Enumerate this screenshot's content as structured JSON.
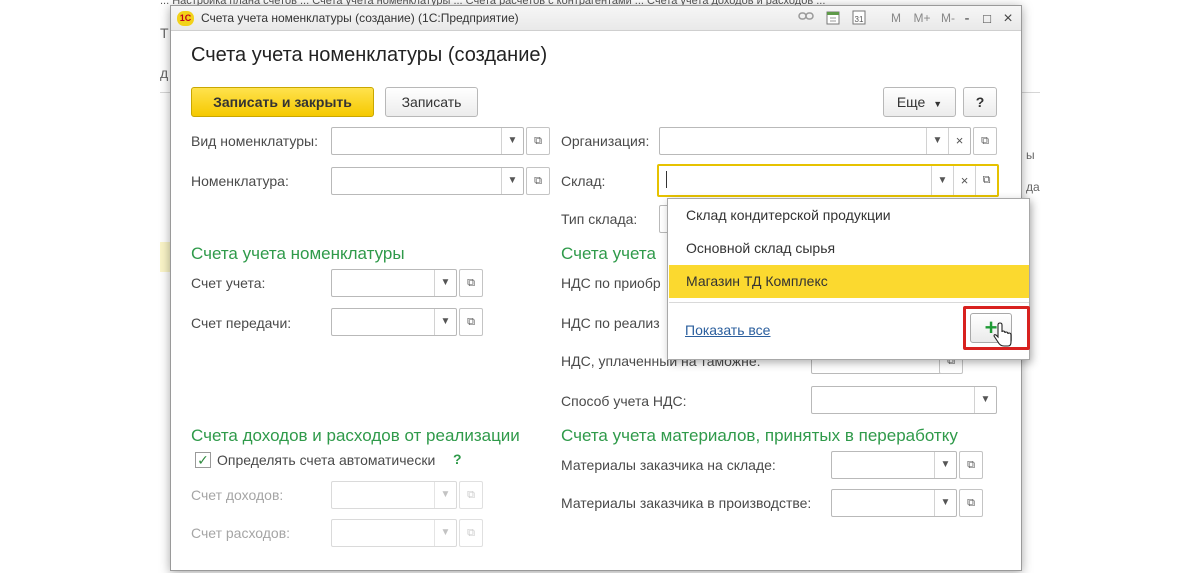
{
  "window": {
    "title": "Счета учета номенклатуры (создание)  (1С:Предприятие)",
    "logo": "1С",
    "toolbar_icons": [
      "link-icon",
      "calendar-icon",
      "calculator-icon"
    ],
    "memory_buttons": [
      "M",
      "M+",
      "M-"
    ],
    "controls": {
      "minimize": "-",
      "maximize": "□",
      "close": "×"
    }
  },
  "background": {
    "tabs_text": "... Настройка плана счетов ... Счета учета номенклатуры ... Счета расчетов с контрагентами ... Счета учета доходов и расходов ...",
    "edge_letters": [
      "Т",
      "д"
    ],
    "right_edge": [
      "ы",
      "да"
    ]
  },
  "page": {
    "title": "Счета учета номенклатуры (создание)"
  },
  "toolbar": {
    "save_close": "Записать и закрыть",
    "save": "Записать",
    "more": "Еще",
    "help": "?"
  },
  "fields": {
    "nomenclature_type": {
      "label": "Вид номенклатуры:",
      "value": ""
    },
    "nomenclature": {
      "label": "Номенклатура:",
      "value": ""
    },
    "organization": {
      "label": "Организация:",
      "value": ""
    },
    "warehouse": {
      "label": "Склад:",
      "value": ""
    },
    "warehouse_type": {
      "label": "Тип склада:"
    }
  },
  "sections": {
    "nomenclature_accounts": {
      "title": "Счета учета номенклатуры",
      "account": "Счет учета:",
      "transfer": "Счет передачи:"
    },
    "vat": {
      "title": "Счета учета",
      "vat_purchase": "НДС по приобр",
      "vat_sales": "НДС по реализ",
      "vat_customs": "НДС, уплаченный на таможне:",
      "vat_method": "Способ учета НДС:"
    },
    "income": {
      "title": "Счета доходов и расходов от реализации",
      "auto_checkbox": "Определять счета автоматически",
      "auto_checked": true,
      "help": "?",
      "income_account": "Счет доходов:",
      "expense_account": "Счет расходов:"
    },
    "materials": {
      "title": "Счета учета материалов, принятых в переработку",
      "in_warehouse": "Материалы заказчика на складе:",
      "in_production": "Материалы заказчика в производстве:"
    }
  },
  "dropdown": {
    "items": [
      "Склад кондитерской продукции",
      " Основной склад сырья",
      "Магазин ТД Комплекс"
    ],
    "selected_index": 2,
    "show_all": "Показать все",
    "add_button": "+"
  },
  "colors": {
    "primary_button": "#f5c900",
    "section_heading": "#2f9a4a",
    "dropdown_selected": "#fbd92f",
    "highlight_frame": "#d8211f",
    "link": "#2b5f9e"
  }
}
